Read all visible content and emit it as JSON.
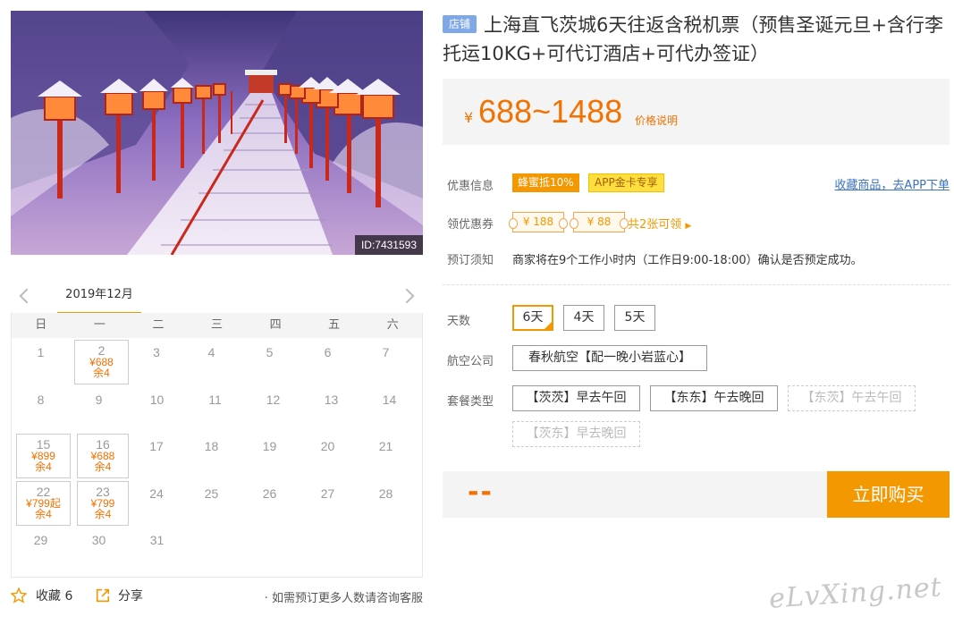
{
  "photo": {
    "id_label": "ID:7431593"
  },
  "calendar": {
    "month": "2019年12月",
    "weekdays": [
      "日",
      "一",
      "二",
      "三",
      "四",
      "五",
      "六"
    ],
    "rows": [
      [
        {
          "d": "1"
        },
        {
          "d": "2",
          "p": "¥688",
          "r": "余4"
        },
        {
          "d": "3"
        },
        {
          "d": "4"
        },
        {
          "d": "5"
        },
        {
          "d": "6"
        },
        {
          "d": "7"
        }
      ],
      [
        {
          "d": "8"
        },
        {
          "d": "9"
        },
        {
          "d": "10"
        },
        {
          "d": "11"
        },
        {
          "d": "12"
        },
        {
          "d": "13"
        },
        {
          "d": "14"
        }
      ],
      [
        {
          "d": "15",
          "p": "¥899",
          "r": "余4"
        },
        {
          "d": "16",
          "p": "¥688",
          "r": "余4"
        },
        {
          "d": "17"
        },
        {
          "d": "18"
        },
        {
          "d": "19"
        },
        {
          "d": "20"
        },
        {
          "d": "21"
        }
      ],
      [
        {
          "d": "22",
          "p": "¥799起",
          "r": "余4"
        },
        {
          "d": "23",
          "p": "¥799",
          "r": "余4"
        },
        {
          "d": "24"
        },
        {
          "d": "25"
        },
        {
          "d": "26"
        },
        {
          "d": "27"
        },
        {
          "d": "28"
        }
      ],
      [
        {
          "d": "29"
        },
        {
          "d": "30"
        },
        {
          "d": "31"
        },
        {
          "d": ""
        },
        {
          "d": ""
        },
        {
          "d": ""
        },
        {
          "d": ""
        }
      ]
    ]
  },
  "bottom": {
    "fav_label": "收藏 6",
    "share_label": "分享",
    "consult_label": "· 如需预订更多人数请咨询客服"
  },
  "product": {
    "shop_tag": "店铺",
    "title": "上海直飞茨城6天往返含税机票（预售圣诞元旦+含行李托运10KG+可代订酒店+可代办签证）",
    "price_currency": "¥",
    "price_range": "688~1488",
    "price_note": "价格说明"
  },
  "info": {
    "discount_label": "优惠信息",
    "tag1": "蜂蜜抵10%",
    "tag2": "APP金卡专享",
    "app_link": "收藏商品，去APP下单",
    "coupon_label": "领优惠券",
    "coupon1": "¥ 188",
    "coupon2": "¥ 88",
    "coupon_more": "共2张可领",
    "notice_label": "预订须知",
    "notice_text": "商家将在9个工作小时内（工作日9:00-18:00）确认是否预定成功。"
  },
  "options": {
    "days_label": "天数",
    "days": [
      "6天",
      "4天",
      "5天"
    ],
    "airline_label": "航空公司",
    "airline": "春秋航空【配一晚小岩蓝心】",
    "package_label": "套餐类型",
    "packages": [
      "【茨茨】早去午回",
      "【东东】午去晚回",
      "【东茨】午去午回",
      "【茨东】早去晚回"
    ]
  },
  "buy": {
    "price_placeholder": "--",
    "button": "立即购买"
  },
  "watermark": "eLvXing.net",
  "colors": {
    "accent": "#f39800",
    "price": "#f37100",
    "link": "#3a72c4",
    "shop_tag": "#7fa8e9"
  }
}
